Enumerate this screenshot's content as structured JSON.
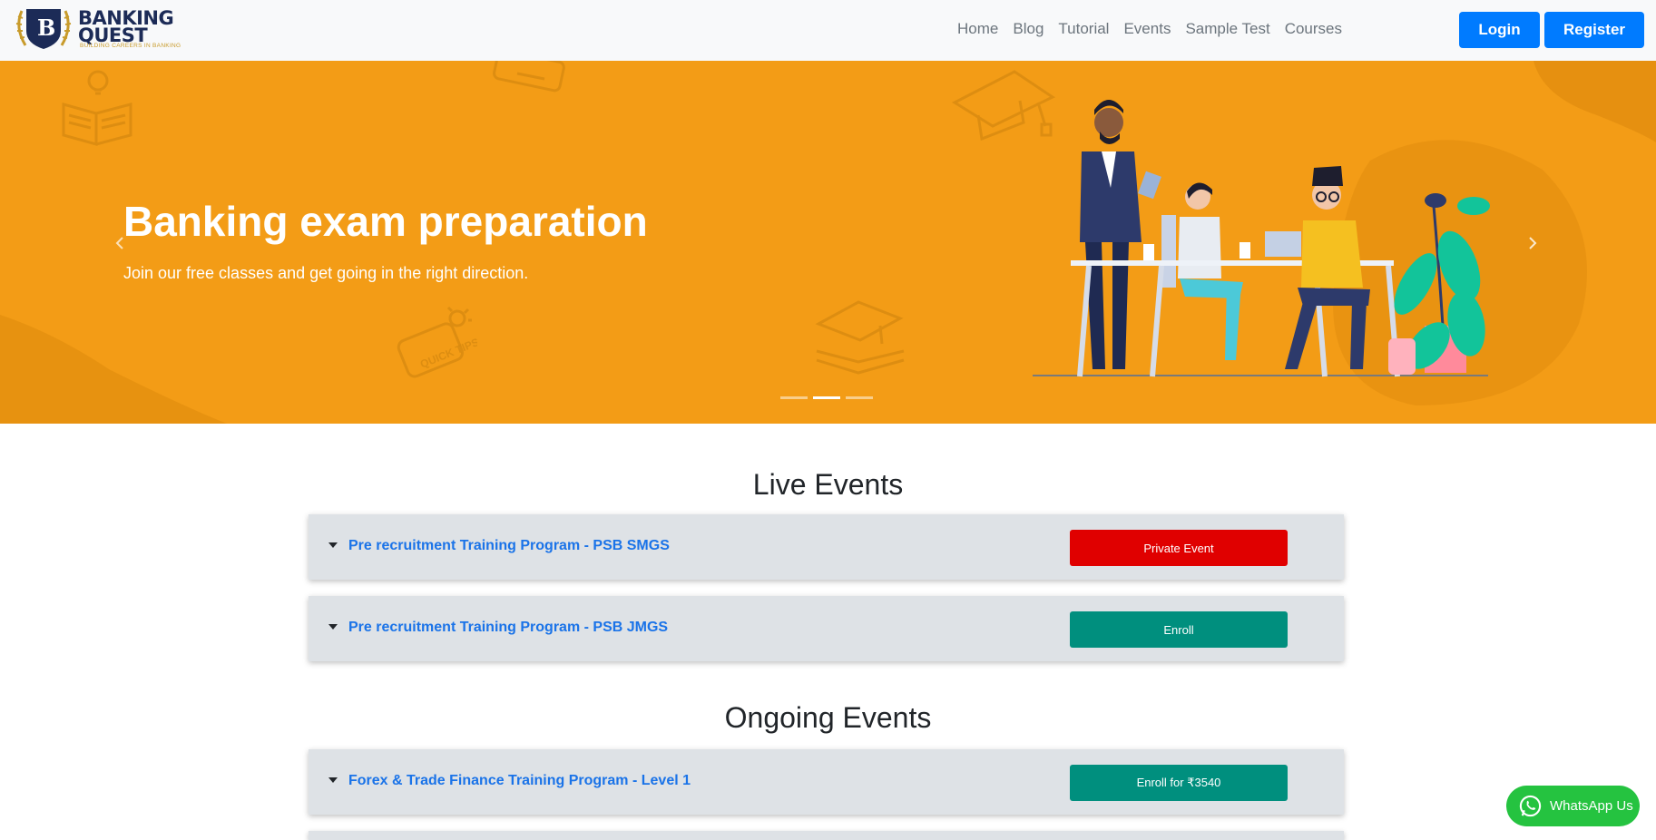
{
  "brand": {
    "logo_letter": "B",
    "line1": "BANKING",
    "line2": "QUEST",
    "tagline": "BUILDING CAREERS IN BANKING"
  },
  "nav": {
    "links": [
      "Home",
      "Blog",
      "Tutorial",
      "Events",
      "Sample Test",
      "Courses"
    ],
    "login": "Login",
    "register": "Register"
  },
  "hero": {
    "title": "Banking exam preparation",
    "subtitle": "Join our free classes and get going in the right direction.",
    "slides_total": 3,
    "active_slide": 2,
    "deco_tip_text": "QUICK TIPS"
  },
  "live_events": {
    "heading": "Live Events",
    "items": [
      {
        "title": "Pre recruitment Training Program - PSB SMGS",
        "button": "Private Event",
        "button_color": "#e00000"
      },
      {
        "title": "Pre recruitment Training Program - PSB JMGS",
        "button": "Enroll",
        "button_color": "#008f7e"
      }
    ]
  },
  "ongoing_events": {
    "heading": "Ongoing Events",
    "items": [
      {
        "title": "Forex & Trade Finance Training Program - Level 1",
        "button": "Enroll for ₹3540",
        "button_color": "#008f7e"
      }
    ]
  },
  "whatsapp": {
    "label": "WhatsApp Us",
    "color": "#25c340"
  },
  "colors": {
    "hero_bg": "#f39c16",
    "primary": "#007bff",
    "link": "#1a73e8"
  }
}
